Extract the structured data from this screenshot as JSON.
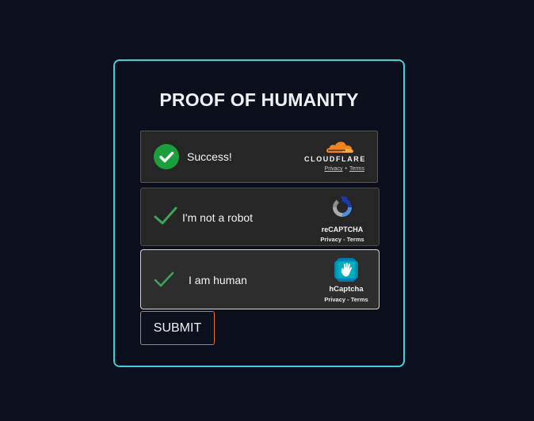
{
  "page": {
    "title": "PROOF OF HUMANITY"
  },
  "cloudflare": {
    "status_label": "Success!",
    "brand": "CLOUDFLARE",
    "privacy_link": "Privacy",
    "separator": "•",
    "terms_link": "Terms"
  },
  "recaptcha": {
    "label": "I'm not a robot",
    "brand": "reCAPTCHA",
    "links": "Privacy - Terms"
  },
  "hcaptcha": {
    "label": "I am human",
    "brand": "hCaptcha",
    "links": "Privacy - Terms"
  },
  "actions": {
    "submit_label": "SUBMIT"
  },
  "colors": {
    "background": "#0b101c",
    "card_border": "#3fd0dc",
    "submit_border": "#e66f2c",
    "success_green": "#1b9e3c",
    "check_green": "#3aa757",
    "cloudflare_orange": "#f48120"
  },
  "icons": {
    "cloudflare_success": "check-circle-icon",
    "cloudflare_logo": "cloudflare-cloud-icon",
    "recaptcha_check": "checkmark-icon",
    "recaptcha_logo": "recaptcha-logo-icon",
    "hcaptcha_check": "checkmark-icon",
    "hcaptcha_logo": "hcaptcha-hand-icon"
  }
}
